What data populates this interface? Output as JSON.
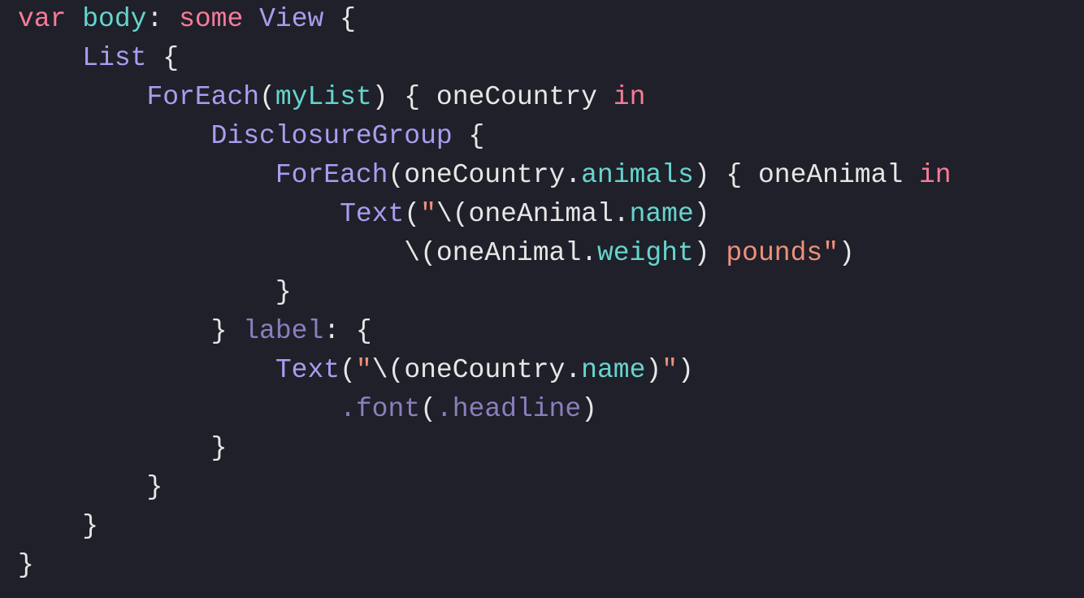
{
  "code": {
    "lines": [
      {
        "indent": 0,
        "tokens": [
          {
            "t": "var",
            "c": "keyword"
          },
          {
            "t": " ",
            "c": "default"
          },
          {
            "t": "body",
            "c": "decl"
          },
          {
            "t": ": ",
            "c": "default"
          },
          {
            "t": "some",
            "c": "keyword"
          },
          {
            "t": " ",
            "c": "default"
          },
          {
            "t": "View",
            "c": "type"
          },
          {
            "t": " {",
            "c": "default"
          }
        ]
      },
      {
        "indent": 1,
        "tokens": [
          {
            "t": "List",
            "c": "type"
          },
          {
            "t": " {",
            "c": "default"
          }
        ]
      },
      {
        "indent": 2,
        "tokens": [
          {
            "t": "ForEach",
            "c": "type"
          },
          {
            "t": "(",
            "c": "default"
          },
          {
            "t": "myList",
            "c": "param"
          },
          {
            "t": ") { oneCountry ",
            "c": "default"
          },
          {
            "t": "in",
            "c": "keyword"
          }
        ]
      },
      {
        "indent": 3,
        "tokens": [
          {
            "t": "DisclosureGroup",
            "c": "type"
          },
          {
            "t": " {",
            "c": "default"
          }
        ]
      },
      {
        "indent": 4,
        "tokens": [
          {
            "t": "ForEach",
            "c": "type"
          },
          {
            "t": "(oneCountry.",
            "c": "default"
          },
          {
            "t": "animals",
            "c": "param"
          },
          {
            "t": ") { oneAnimal ",
            "c": "default"
          },
          {
            "t": "in",
            "c": "keyword"
          }
        ]
      },
      {
        "indent": 5,
        "tokens": [
          {
            "t": "Text",
            "c": "type"
          },
          {
            "t": "(",
            "c": "default"
          },
          {
            "t": "\"",
            "c": "string"
          },
          {
            "t": "\\(",
            "c": "default"
          },
          {
            "t": "oneAnimal.",
            "c": "default"
          },
          {
            "t": "name",
            "c": "param"
          },
          {
            "t": ")",
            "c": "default"
          }
        ]
      },
      {
        "indent": 6,
        "tokens": [
          {
            "t": "\\(",
            "c": "default"
          },
          {
            "t": "oneAnimal.",
            "c": "default"
          },
          {
            "t": "weight",
            "c": "param"
          },
          {
            "t": ")",
            "c": "default"
          },
          {
            "t": " pounds\"",
            "c": "string"
          },
          {
            "t": ")",
            "c": "default"
          }
        ]
      },
      {
        "indent": 4,
        "tokens": [
          {
            "t": "}",
            "c": "default"
          }
        ]
      },
      {
        "indent": 3,
        "tokens": [
          {
            "t": "} ",
            "c": "default"
          },
          {
            "t": "label",
            "c": "label"
          },
          {
            "t": ": {",
            "c": "default"
          }
        ]
      },
      {
        "indent": 4,
        "tokens": [
          {
            "t": "Text",
            "c": "type"
          },
          {
            "t": "(",
            "c": "default"
          },
          {
            "t": "\"",
            "c": "string"
          },
          {
            "t": "\\(",
            "c": "default"
          },
          {
            "t": "oneCountry.",
            "c": "default"
          },
          {
            "t": "name",
            "c": "param"
          },
          {
            "t": ")",
            "c": "default"
          },
          {
            "t": "\"",
            "c": "string"
          },
          {
            "t": ")",
            "c": "default"
          }
        ]
      },
      {
        "indent": 5,
        "tokens": [
          {
            "t": ".font",
            "c": "label"
          },
          {
            "t": "(",
            "c": "default"
          },
          {
            "t": ".headline",
            "c": "label"
          },
          {
            "t": ")",
            "c": "default"
          }
        ]
      },
      {
        "indent": 3,
        "tokens": [
          {
            "t": "}",
            "c": "default"
          }
        ]
      },
      {
        "indent": 2,
        "tokens": [
          {
            "t": "}",
            "c": "default"
          }
        ]
      },
      {
        "indent": 1,
        "tokens": [
          {
            "t": "}",
            "c": "default"
          }
        ]
      },
      {
        "indent": 0,
        "tokens": [
          {
            "t": "}",
            "c": "default"
          }
        ]
      }
    ]
  }
}
